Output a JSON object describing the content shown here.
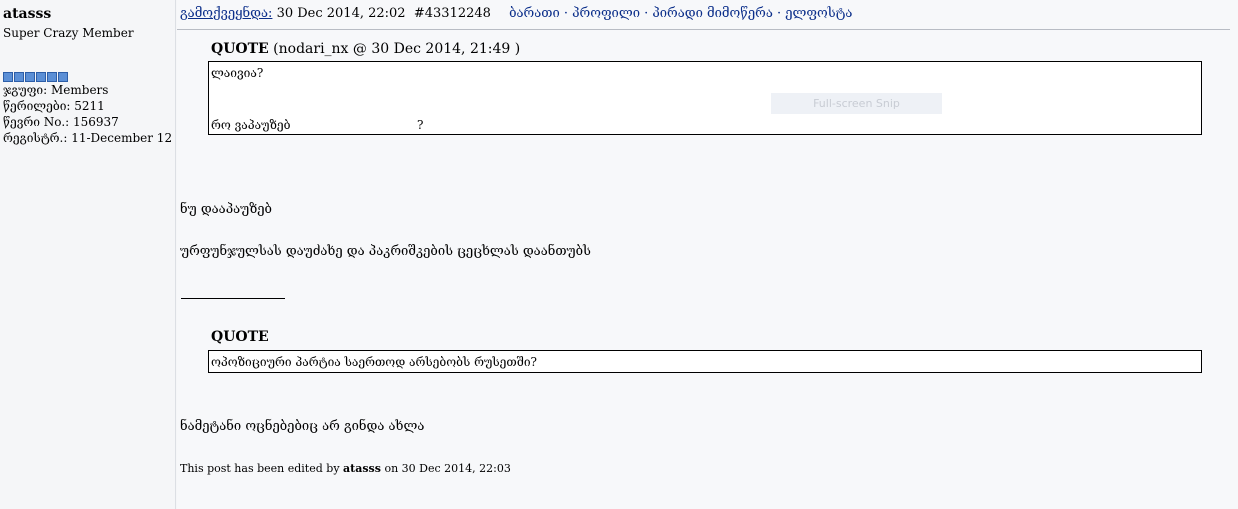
{
  "user": {
    "name": "atasss",
    "rank": "Super Crazy Member",
    "group": "ჯგუფი: Members",
    "posts": "წერილები: 5211",
    "member_no": "წევრი No.: 156937",
    "registered": "რეგისტრ.: 11-December 12"
  },
  "post": {
    "posted_label": "გამოქვეყნდა:",
    "date": "30 Dec 2014, 22:02",
    "post_id": "#43312248",
    "links": "ბარათი · პროფილი · პირადი მიმოწერა · ელფოსტა"
  },
  "quote1": {
    "label": "QUOTE",
    "attribution": "(nodari_nx @ 30 Dec 2014, 21:49 )",
    "line1": "ლაივია?",
    "line2": "რო ვაპაუზებ",
    "line2_tail": "?"
  },
  "overlay": {
    "label": "Full-screen Snip"
  },
  "body": {
    "p1": "ნუ დააპაუზებ",
    "p2": "ურფუნჯულსას დაუძახე და პაკრიშკების ცეცხლას დაანთუბს"
  },
  "quote2": {
    "label": "QUOTE",
    "text": "ოპოზიციური პარტია საერთოდ არსებობს რუსეთში?"
  },
  "body2": {
    "p3": "ნამეტანი ოცნებებიც არ გინდა ახლა"
  },
  "edit": {
    "prefix": "This post has been edited by",
    "user": "atasss",
    "suffix": "on 30 Dec 2014, 22:03"
  }
}
